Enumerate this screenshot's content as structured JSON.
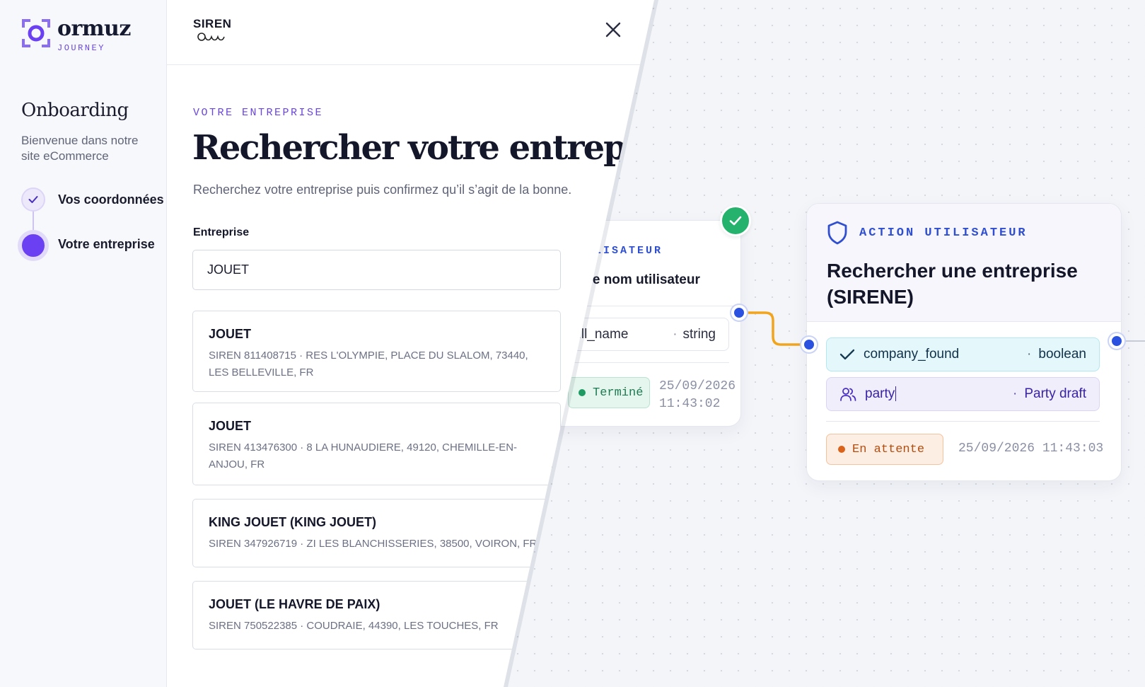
{
  "brand": {
    "name": "ormuz",
    "product": "JOURNEY"
  },
  "sidebar": {
    "title": "Onboarding",
    "description": "Bienvenue dans notre site eCommerce",
    "steps": [
      {
        "label": "Vos coordonnées",
        "state": "done"
      },
      {
        "label": "Votre entreprise",
        "state": "current"
      }
    ]
  },
  "sheet": {
    "provider": "SIREN",
    "eyebrow": "VOTRE ENTREPRISE",
    "title": "Rechercher votre entreprise",
    "subtitle": "Recherchez votre entreprise puis confirmez qu’il s’agit de la bonne.",
    "field_label": "Entreprise",
    "search_value": "JOUET",
    "results": [
      {
        "name": "JOUET",
        "info": "SIREN 811408715 · RES L'OLYMPIE, PLACE DU SLALOM, 73440, LES BELLEVILLE, FR"
      },
      {
        "name": "JOUET",
        "info": "SIREN 413476300 · 8 LA HUNAUDIERE, 49120, CHEMILLE-EN-ANJOU, FR"
      },
      {
        "name": "KING JOUET (KING JOUET)",
        "info": "SIREN 347926719 · ZI LES BLANCHISSERIES, 38500, VOIRON, FR"
      },
      {
        "name": "JOUET (LE HAVRE DE PAIX)",
        "info": "SIREN 750522385 · COUDRAIE, 44390, LES TOUCHES, FR"
      }
    ]
  },
  "canvas": {
    "prev_node": {
      "kind": "UTILISATEUR",
      "title": "ter le nom utilisateur",
      "field": {
        "name": "full_name",
        "type": "string"
      },
      "status": "Terminé",
      "date": "25/09/2026",
      "time": "11:43:02"
    },
    "main_node": {
      "kind": "ACTION UTILISATEUR",
      "title": "Rechercher une entreprise (SIRENE)",
      "fields": [
        {
          "name": "company_found",
          "type": "boolean"
        },
        {
          "name": "party",
          "type": "Party draft"
        }
      ],
      "status": "En attente",
      "datetime": "25/09/2026 11:43:03"
    }
  },
  "colors": {
    "accent_purple": "#6b3ff2",
    "node_blue": "#2a51e0",
    "connector_orange": "#f2a51c",
    "success_green": "#25b26c",
    "pending_orange": "#d9631a"
  }
}
